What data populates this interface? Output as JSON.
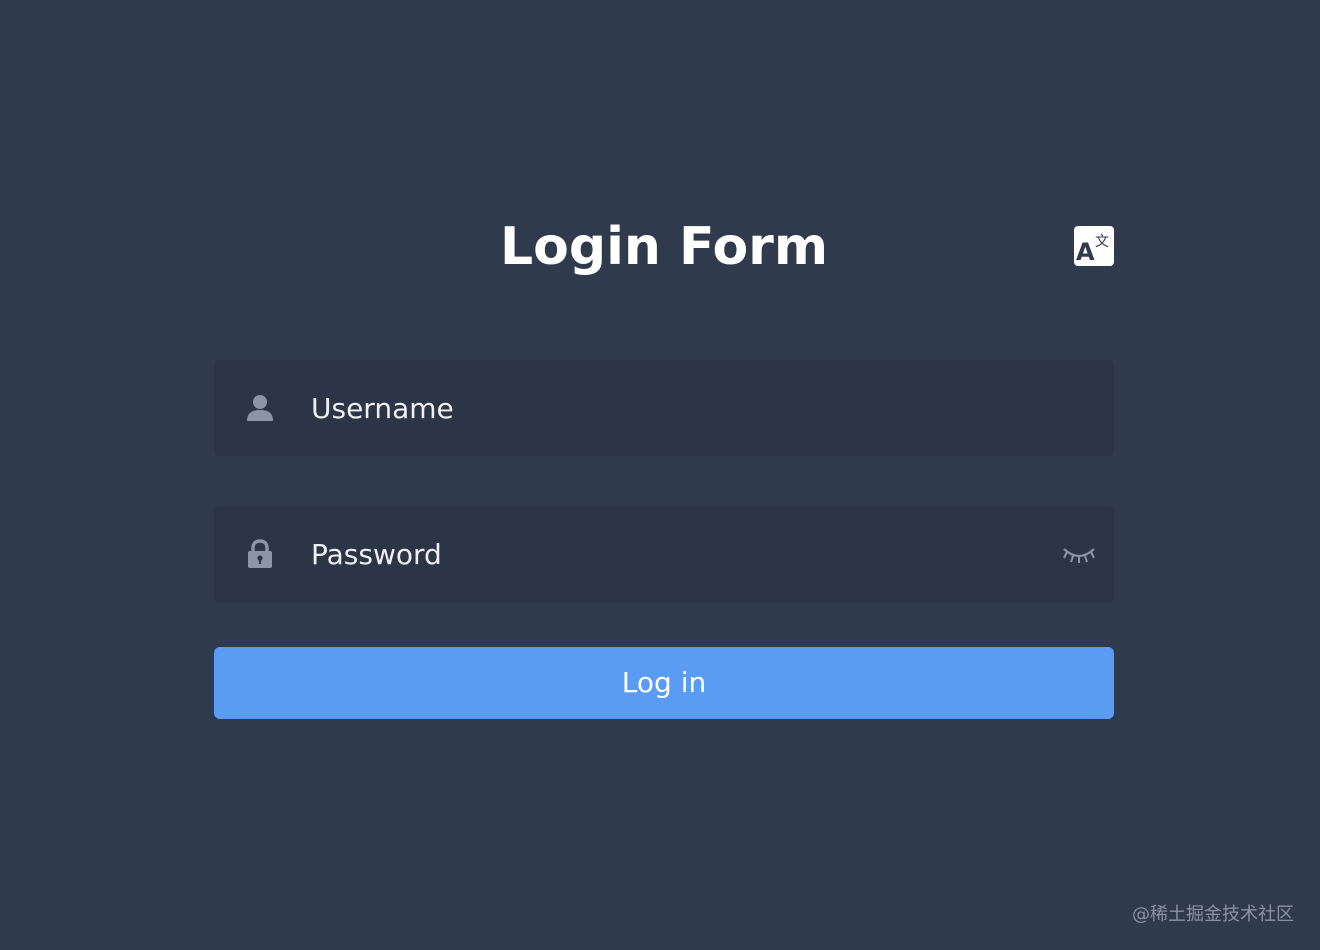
{
  "form": {
    "title": "Login Form",
    "username": {
      "placeholder": "Username",
      "value": "",
      "icon": "user-icon"
    },
    "password": {
      "placeholder": "Password",
      "value": "",
      "icon": "lock-icon",
      "toggle_icon": "eye-closed-icon"
    },
    "login_label": "Log in",
    "language_icon": "translate-icon"
  },
  "watermark": "@稀土掘金技术社区",
  "colors": {
    "background": "#2f3a4c",
    "input_background": "#2c3545",
    "accent": "#5a9bf4",
    "icon": "#8c95a6"
  }
}
